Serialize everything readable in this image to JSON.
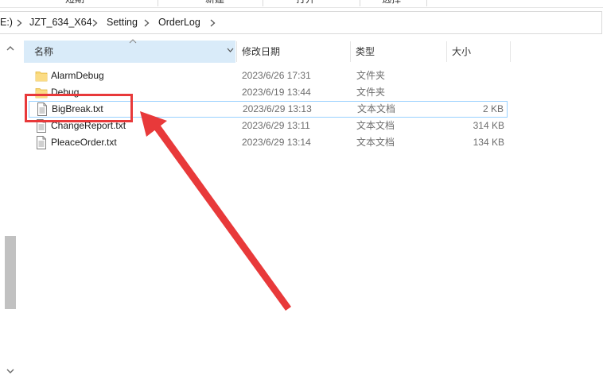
{
  "ribbon": {
    "fragments": [
      "短期",
      "新建",
      "打开",
      "选择"
    ]
  },
  "address": {
    "drive": "E:)",
    "crumbs": [
      "JZT_634_X64",
      "Setting",
      "OrderLog"
    ]
  },
  "columns": {
    "name": "名称",
    "date": "修改日期",
    "type": "类型",
    "size": "大小"
  },
  "files": [
    {
      "name": "AlarmDebug",
      "date": "2023/6/26 17:31",
      "type": "文件夹",
      "size": "",
      "icon": "folder-icon"
    },
    {
      "name": "Debug",
      "date": "2023/6/19 13:44",
      "type": "文件夹",
      "size": "",
      "icon": "folder-icon"
    },
    {
      "name": "BigBreak.txt",
      "date": "2023/6/29 13:13",
      "type": "文本文档",
      "size": "2 KB",
      "icon": "text-file-icon",
      "selected": true
    },
    {
      "name": "ChangeReport.txt",
      "date": "2023/6/29 13:11",
      "type": "文本文档",
      "size": "314 KB",
      "icon": "text-file-icon"
    },
    {
      "name": "PleaceOrder.txt",
      "date": "2023/6/29 13:14",
      "type": "文本文档",
      "size": "134 KB",
      "icon": "text-file-icon"
    }
  ],
  "colors": {
    "annotation": "#e8393a",
    "header_highlight": "#d9ebf9",
    "selection_border": "#99d1ff",
    "folder": "#f8d775"
  }
}
